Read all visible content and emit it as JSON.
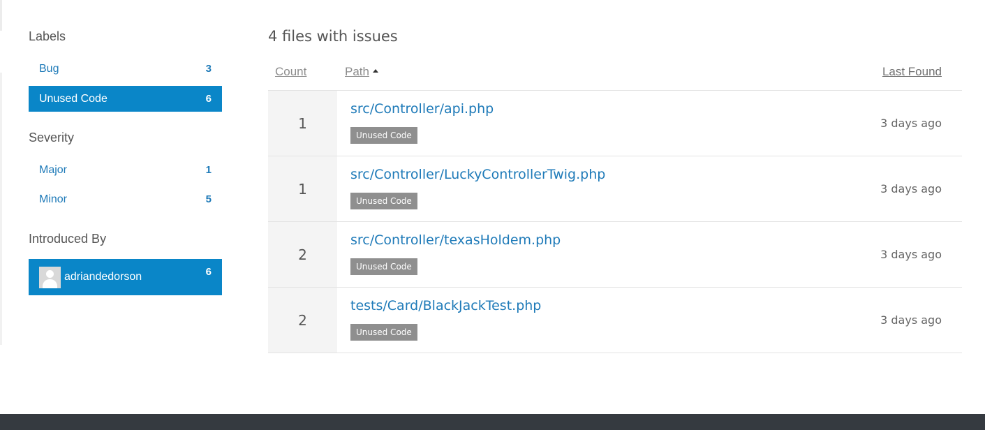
{
  "sidebar": {
    "labels": {
      "title": "Labels",
      "items": [
        {
          "label": "Bug",
          "count": "3"
        },
        {
          "label": "Unused Code",
          "count": "6"
        }
      ]
    },
    "severity": {
      "title": "Severity",
      "items": [
        {
          "label": "Major",
          "count": "1"
        },
        {
          "label": "Minor",
          "count": "5"
        }
      ]
    },
    "introduced_by": {
      "title": "Introduced By",
      "items": [
        {
          "label": "adriandedorson",
          "count": "6"
        }
      ]
    }
  },
  "main": {
    "title": "4 files with issues",
    "columns": {
      "count": "Count",
      "path": "Path",
      "last_found": "Last Found"
    },
    "rows": [
      {
        "count": "1",
        "path": "src/Controller/api.php",
        "tag": "Unused Code",
        "found": "3 days ago"
      },
      {
        "count": "1",
        "path": "src/Controller/LuckyControllerTwig.php",
        "tag": "Unused Code",
        "found": "3 days ago"
      },
      {
        "count": "2",
        "path": "src/Controller/texasHoldem.php",
        "tag": "Unused Code",
        "found": "3 days ago"
      },
      {
        "count": "2",
        "path": "tests/Card/BlackJackTest.php",
        "tag": "Unused Code",
        "found": "3 days ago"
      }
    ]
  },
  "colors": {
    "accent": "#0a86c8",
    "link": "#1e7ab8",
    "tag": "#8f8f8f",
    "footer": "#353a40"
  }
}
